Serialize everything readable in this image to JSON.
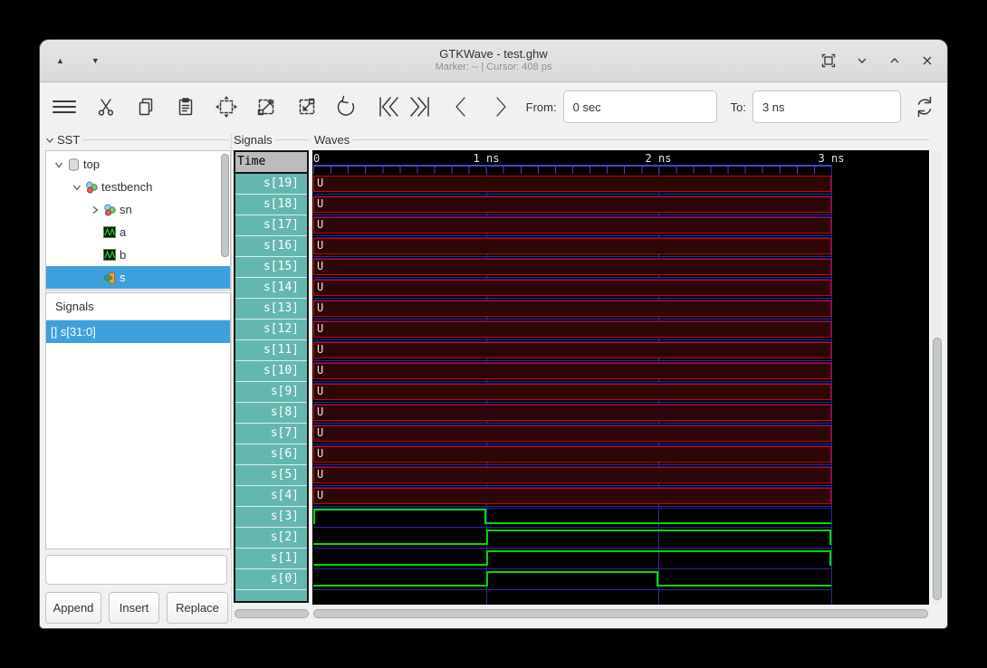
{
  "window": {
    "title": "GTKWave - test.ghw",
    "subtitle": "Marker: --  |  Cursor: 408 ps"
  },
  "titlebar": {
    "controls": [
      "scroll-up",
      "scroll-down",
      "fit-to-window",
      "unshade",
      "shade",
      "close"
    ]
  },
  "toolbar": {
    "icons": [
      "menu",
      "cut",
      "copy",
      "paste",
      "zoom-fit",
      "zoom-in",
      "zoom-out",
      "undo",
      "go-to-start",
      "go-to-end",
      "previous-edge",
      "next-edge",
      "reload"
    ],
    "from_label": "From:",
    "from_value": "0 sec",
    "to_label": "To:",
    "to_value": "3 ns"
  },
  "sst": {
    "header": "SST",
    "tree": [
      {
        "label": "top",
        "icon": "database",
        "depth": 0,
        "expander": "expanded",
        "selected": false
      },
      {
        "label": "testbench",
        "icon": "module",
        "depth": 1,
        "expander": "expanded",
        "selected": false
      },
      {
        "label": "sn",
        "icon": "module",
        "depth": 2,
        "expander": "collapsed",
        "selected": false
      },
      {
        "label": "a",
        "icon": "waveform",
        "depth": 2,
        "expander": "none",
        "selected": false
      },
      {
        "label": "b",
        "icon": "waveform",
        "depth": 2,
        "expander": "none",
        "selected": false
      },
      {
        "label": "s",
        "icon": "signal-exit",
        "depth": 2,
        "expander": "none",
        "selected": true
      }
    ]
  },
  "signals_list": {
    "header": "Signals",
    "items": [
      {
        "label": "[] s[31:0]",
        "selected": true
      }
    ]
  },
  "search": {
    "value": "",
    "icon": "search"
  },
  "actions": {
    "append": "Append",
    "insert": "Insert",
    "replace": "Replace"
  },
  "names_panel": {
    "frame_label": "Signals",
    "time_label": "Time"
  },
  "waves": {
    "frame_label": "Waves",
    "timeline": [
      {
        "t": 0,
        "label": "0"
      },
      {
        "t": 1,
        "label": "1 ns"
      },
      {
        "t": 2,
        "label": "2 ns"
      },
      {
        "t": 3,
        "label": "3 ns"
      }
    ],
    "t_end": 3,
    "signals": [
      {
        "name": "s[19]",
        "kind": "bus",
        "value": "U"
      },
      {
        "name": "s[18]",
        "kind": "bus",
        "value": "U"
      },
      {
        "name": "s[17]",
        "kind": "bus",
        "value": "U"
      },
      {
        "name": "s[16]",
        "kind": "bus",
        "value": "U"
      },
      {
        "name": "s[15]",
        "kind": "bus",
        "value": "U"
      },
      {
        "name": "s[14]",
        "kind": "bus",
        "value": "U"
      },
      {
        "name": "s[13]",
        "kind": "bus",
        "value": "U"
      },
      {
        "name": "s[12]",
        "kind": "bus",
        "value": "U"
      },
      {
        "name": "s[11]",
        "kind": "bus",
        "value": "U"
      },
      {
        "name": "s[10]",
        "kind": "bus",
        "value": "U"
      },
      {
        "name": "s[9]",
        "kind": "bus",
        "value": "U"
      },
      {
        "name": "s[8]",
        "kind": "bus",
        "value": "U"
      },
      {
        "name": "s[7]",
        "kind": "bus",
        "value": "U"
      },
      {
        "name": "s[6]",
        "kind": "bus",
        "value": "U"
      },
      {
        "name": "s[5]",
        "kind": "bus",
        "value": "U"
      },
      {
        "name": "s[4]",
        "kind": "bus",
        "value": "U"
      },
      {
        "name": "s[3]",
        "kind": "bit",
        "segments": [
          [
            0,
            1,
            1
          ],
          [
            1,
            3,
            0
          ]
        ]
      },
      {
        "name": "s[2]",
        "kind": "bit",
        "segments": [
          [
            0,
            1,
            0
          ],
          [
            1,
            3,
            1
          ]
        ]
      },
      {
        "name": "s[1]",
        "kind": "bit",
        "segments": [
          [
            0,
            1,
            0
          ],
          [
            1,
            3,
            1
          ]
        ]
      },
      {
        "name": "s[0]",
        "kind": "bit",
        "segments": [
          [
            0,
            1,
            0
          ],
          [
            1,
            2,
            1
          ],
          [
            2,
            3,
            0
          ]
        ]
      }
    ]
  },
  "colors": {
    "selection": "#3da0dc",
    "signal_name_bg": "#64b7af",
    "wave_u_border": "#d40000",
    "wave_u_fill": "#2d0707",
    "wave_bit_green": "#00d800",
    "grid_blue": "#2a2aa8",
    "ruler_blue": "#4646c8"
  }
}
